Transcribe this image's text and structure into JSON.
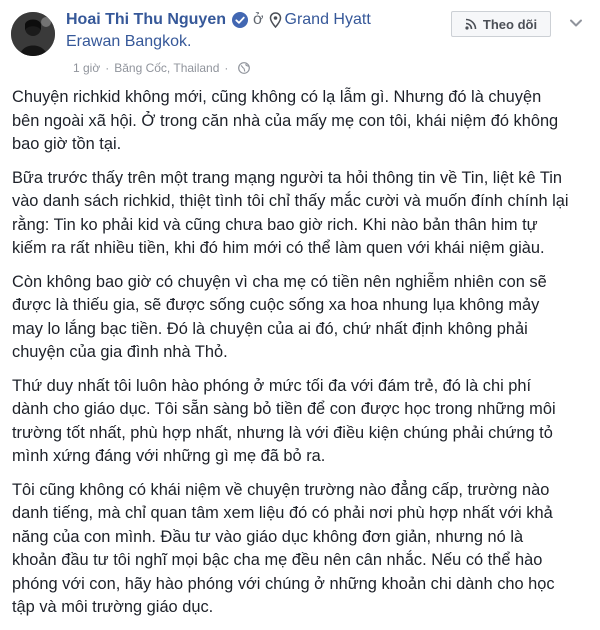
{
  "post": {
    "author": "Hoai Thi Thu Nguyen",
    "is_at": "ở",
    "place_line1": "Grand Hyatt",
    "place_line2": "Erawan Bangkok.",
    "time": "1 giờ",
    "dot": "·",
    "location": "Băng Cốc, Thailand",
    "follow_label": "Theo dõi",
    "paragraphs": [
      "Chuyện richkid không mới, cũng không có lạ lẫm gì. Nhưng đó là chuyện\nbên ngoài xã hội. Ở trong căn nhà của mấy mẹ con tôi, khái niệm đó không\nbao giờ tồn tại.",
      "Bữa trước thấy trên một trang mạng người ta hỏi thông tin về Tin, liệt kê Tin\nvào danh sách richkid, thiệt tình tôi chỉ thấy mắc cười và muốn đính chính lại\nrằng: Tin ko phải kid và cũng chưa bao giờ rich. Khi nào bản thân him tự\nkiếm ra rất nhiều tiền, khi đó him mới có thể làm quen với khái niệm giàu.",
      "Còn không bao giờ có chuyện vì cha mẹ có tiền nên nghiễm nhiên con sẽ\nđược là thiếu gia, sẽ được sống cuộc sống xa hoa nhung lụa không mảy\nmay lo lắng bạc tiền. Đó là chuyện của ai đó, chứ nhất định không phải\nchuyện của gia đình nhà Thỏ.",
      "Thứ duy nhất tôi luôn hào phóng ở mức tối đa với đám trẻ, đó là chi phí\ndành cho giáo dục. Tôi sẵn sàng bỏ tiền để con được học trong những môi\ntrường tốt nhất, phù hợp nhất, nhưng là với điều kiện chúng phải chứng tỏ\nmình xứng đáng với những gì mẹ đã bỏ ra.",
      "Tôi cũng không có khái niệm về chuyện trường nào đẳng cấp, trường nào\ndanh tiếng, mà chỉ quan tâm xem liệu đó có phải nơi phù hợp nhất với khả\nnăng của con mình. Đầu tư vào giáo dục không đơn giản, nhưng nó là\nkhoản đầu tư tôi nghĩ mọi bậc cha mẹ đều nên cân nhắc. Nếu có thể hào\nphóng với con, hãy hào phóng với chúng ở những khoản chi dành cho học\ntập và môi trường giáo dục."
    ]
  },
  "icons": {
    "verified": "verified-badge-icon",
    "location": "location-pin-icon",
    "privacy": "globe-icon",
    "follow": "rss-feed-icon",
    "more": "chevron-down-icon"
  },
  "colors": {
    "link": "#365899",
    "text": "#1d2129",
    "meta": "#90949c",
    "verified": "#4267b2"
  }
}
